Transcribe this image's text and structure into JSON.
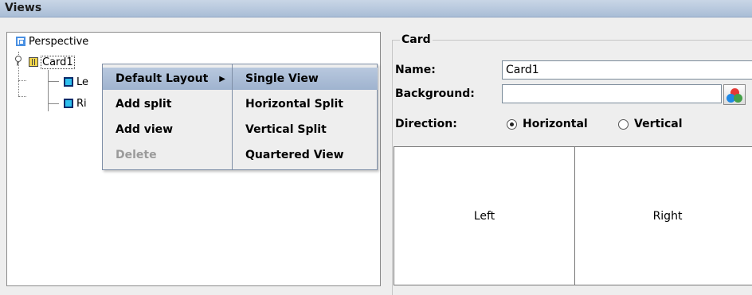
{
  "window": {
    "title": "Views"
  },
  "tree": {
    "items": [
      {
        "label": "Perspective",
        "icon": "perspective-icon"
      },
      {
        "label": "Card1",
        "icon": "card-icon"
      },
      {
        "label": "Le",
        "icon": "view-icon"
      },
      {
        "label": "Ri",
        "icon": "view-icon"
      }
    ]
  },
  "context_menu": {
    "items": [
      {
        "label": "Default Layout",
        "has_submenu": true
      },
      {
        "label": "Add split"
      },
      {
        "label": "Add view"
      },
      {
        "label": "Delete",
        "disabled": true
      }
    ],
    "submenu": {
      "items": [
        {
          "label": "Single View",
          "highlighted": true
        },
        {
          "label": "Horizontal Split"
        },
        {
          "label": "Vertical Split"
        },
        {
          "label": "Quartered View"
        }
      ]
    }
  },
  "card_panel": {
    "title": "Card",
    "name_label": "Name:",
    "name_value": "Card1",
    "background_label": "Background:",
    "background_value": "",
    "direction_label": "Direction:",
    "direction_options": [
      {
        "label": "Horizontal",
        "selected": true
      },
      {
        "label": "Vertical",
        "selected": false
      }
    ],
    "preview": {
      "left_label": "Left",
      "right_label": "Right"
    }
  },
  "colors": {
    "menu_highlight": "#a9bdd6",
    "titlebar": "#b8c8de",
    "view_icon": "#2fc0ee",
    "card_icon": "#f3d64b"
  }
}
